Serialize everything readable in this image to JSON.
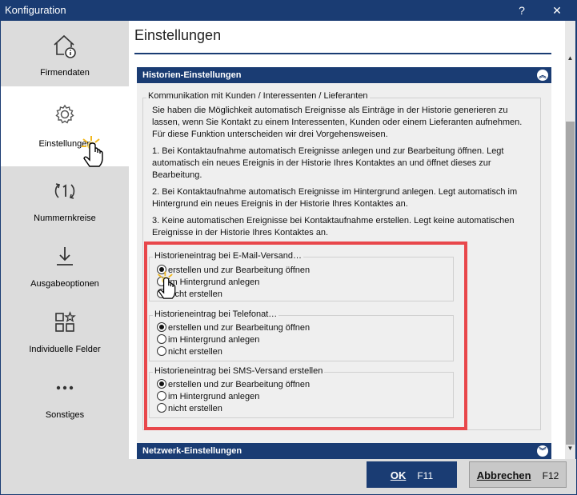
{
  "window": {
    "title": "Konfiguration",
    "help": "?",
    "close": "✕"
  },
  "sidebar": {
    "items": [
      {
        "label": "Firmendaten",
        "icon": "house-info-icon"
      },
      {
        "label": "Einstellungen",
        "icon": "gear-icon",
        "active": true
      },
      {
        "label": "Nummernkreise",
        "icon": "refresh-number-icon"
      },
      {
        "label": "Ausgabeoptionen",
        "icon": "download-icon"
      },
      {
        "label": "Individuelle Felder",
        "icon": "grid-star-icon"
      },
      {
        "label": "Sonstiges",
        "icon": "more-dots-icon"
      }
    ]
  },
  "main": {
    "page_title": "Einstellungen",
    "section_history": {
      "header": "Historien-Einstellungen",
      "group_title": "Kommunikation mit Kunden / Interessenten / Lieferanten",
      "intro": "Sie haben die Möglichkeit automatisch Ereignisse als Einträge in der Historie generieren zu lassen, wenn Sie Kontakt zu einem Interessenten, Kunden oder einem Lieferanten aufnehmen. Für diese Funktion unterscheiden wir drei Vorgehensweisen.",
      "option1": "1. Bei Kontaktaufnahme automatisch Ereignisse anlegen und zur Bearbeitung öffnen. Legt automatisch ein neues Ereignis in der Historie Ihres Kontaktes an und öffnet dieses zur Bearbeitung.",
      "option2": "2. Bei Kontaktaufnahme automatisch Ereignisse im Hintergrund anlegen. Legt automatisch im Hintergrund ein neues Ereignis in der Historie Ihres Kontaktes an.",
      "option3": "3. Keine automatischen Ereignisse bei Kontaktaufnahme erstellen. Legt keine automatischen Ereignisse in der Historie Ihres Kontaktes an.",
      "groups": [
        {
          "title": "Historieneintrag bei E-Mail-Versand…",
          "options": [
            "erstellen und zur Bearbeitung öffnen",
            "im Hintergrund anlegen",
            "nicht erstellen"
          ],
          "selected": 0
        },
        {
          "title": "Historieneintrag bei Telefonat…",
          "options": [
            "erstellen und zur Bearbeitung öffnen",
            "im Hintergrund anlegen",
            "nicht erstellen"
          ],
          "selected": 0
        },
        {
          "title": "Historieneintrag bei SMS-Versand erstellen",
          "options": [
            "erstellen und zur Bearbeitung öffnen",
            "im Hintergrund anlegen",
            "nicht erstellen"
          ],
          "selected": 0
        }
      ]
    },
    "section_network": {
      "header": "Netzwerk-Einstellungen"
    }
  },
  "footer": {
    "ok_label": "OK",
    "ok_key": "F11",
    "cancel_label": "Abbrechen",
    "cancel_key": "F12"
  },
  "colors": {
    "accent": "#1a3c73",
    "highlight": "#e8474b",
    "sidebar_bg": "#dcdcdc",
    "panel_bg": "#efefef"
  }
}
